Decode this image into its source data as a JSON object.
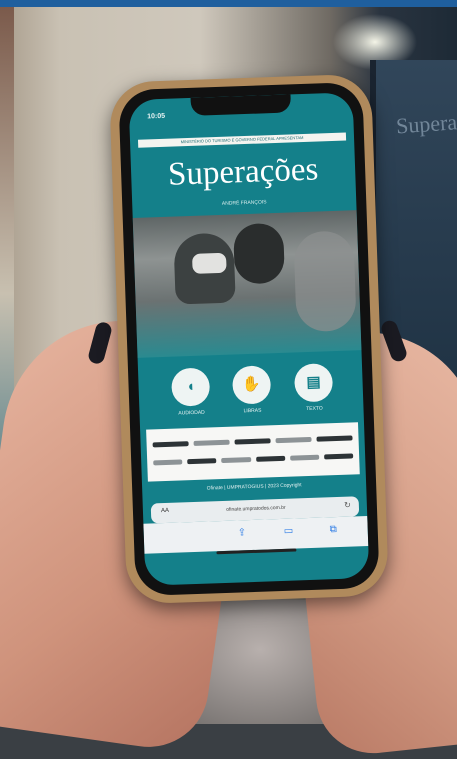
{
  "photo": {
    "phone_app": {
      "status_time": "10:05",
      "top_note": "MINISTÉRIO DO TURISMO E GOVERNO FEDERAL APRESENTAM",
      "title": "Superações",
      "author": "ANDRÉ FRANÇOIS",
      "buttons": [
        {
          "label": "AUDIODAD",
          "icon": "ear-icon"
        },
        {
          "label": "LIBRAS",
          "icon": "hands-icon"
        },
        {
          "label": "TEXTO",
          "icon": "document-icon"
        }
      ],
      "copyright": "Ofinate | UMPRATOGIUS | 2023 Copyright",
      "browser": {
        "aa": "AA",
        "url": "ofinate.umpratodos.com.br"
      }
    },
    "background_sign_text": "Superações"
  }
}
